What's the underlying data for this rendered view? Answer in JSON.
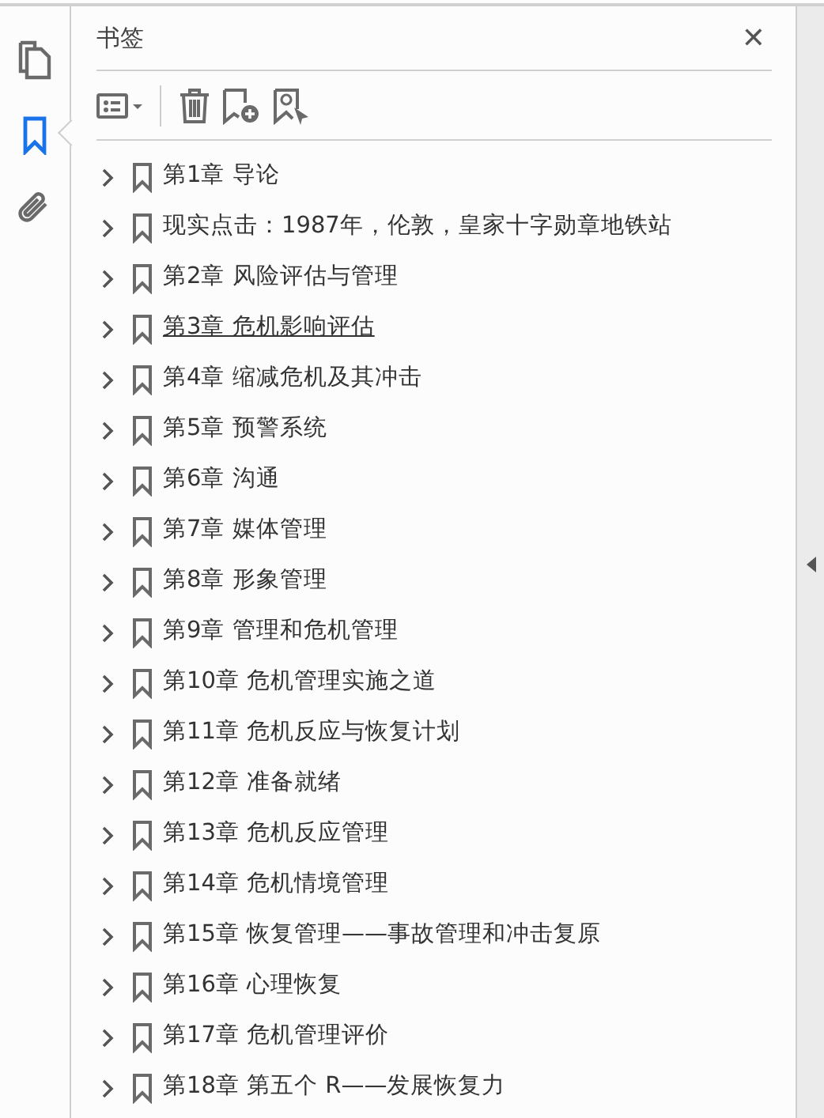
{
  "rail": [
    {
      "kind": "pages",
      "selected": false
    },
    {
      "kind": "bookmarks",
      "selected": true
    },
    {
      "kind": "attachments",
      "selected": false
    }
  ],
  "panel": {
    "title": "书签",
    "close": "✕"
  },
  "toolbar": [
    {
      "kind": "options"
    },
    {
      "kind": "delete"
    },
    {
      "kind": "new"
    },
    {
      "kind": "find"
    }
  ],
  "bookmarks": [
    {
      "label": "第1章  导论",
      "hovered": false
    },
    {
      "label": "现实点击：1987年，伦敦，皇家十字勋章地铁站",
      "hovered": false
    },
    {
      "label": "第2章  风险评估与管理",
      "hovered": false
    },
    {
      "label": "第3章  危机影响评估",
      "hovered": true
    },
    {
      "label": "第4章  缩减危机及其冲击",
      "hovered": false
    },
    {
      "label": "第5章  预警系统",
      "hovered": false
    },
    {
      "label": "第6章  沟通",
      "hovered": false
    },
    {
      "label": "第7章  媒体管理",
      "hovered": false
    },
    {
      "label": "第8章  形象管理",
      "hovered": false
    },
    {
      "label": "第9章  管理和危机管理",
      "hovered": false
    },
    {
      "label": "第10章  危机管理实施之道",
      "hovered": false
    },
    {
      "label": "第11章  危机反应与恢复计划",
      "hovered": false
    },
    {
      "label": "第12章  准备就绪",
      "hovered": false
    },
    {
      "label": "第13章  危机反应管理",
      "hovered": false
    },
    {
      "label": "第14章  危机情境管理",
      "hovered": false
    },
    {
      "label": "第15章  恢复管理——事故管理和冲击复原",
      "hovered": false
    },
    {
      "label": "第16章  心理恢复",
      "hovered": false
    },
    {
      "label": "第17章  危机管理评价",
      "hovered": false
    },
    {
      "label": "第18章  第五个 R——发展恢复力",
      "hovered": false
    }
  ]
}
